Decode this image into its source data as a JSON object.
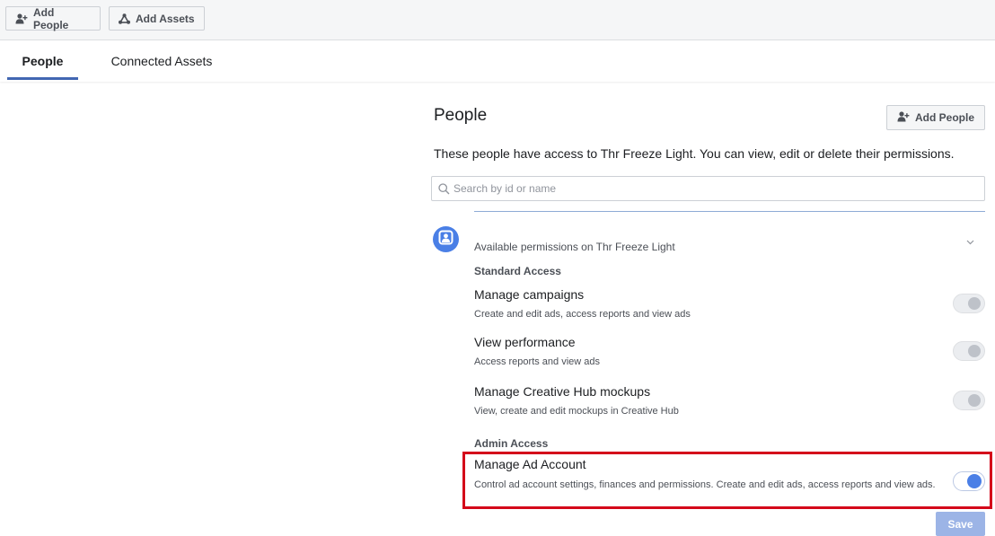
{
  "toolbar": {
    "add_people_label": "Add People",
    "add_assets_label": "Add Assets"
  },
  "tabs": [
    {
      "label": "People",
      "active": true
    },
    {
      "label": "Connected Assets",
      "active": false
    }
  ],
  "panel": {
    "title": "People",
    "add_people_label": "Add People",
    "description": "These people have access to Thr Freeze Light. You can view, edit or delete their permissions.",
    "search_placeholder": "Search by id or name",
    "available_label": "Available permissions on Thr Freeze Light",
    "standard_heading": "Standard Access",
    "admin_heading": "Admin Access",
    "permissions": [
      {
        "title": "Manage campaigns",
        "description": "Create and edit ads, access reports and view ads",
        "enabled": false
      },
      {
        "title": "View performance",
        "description": "Access reports and view ads",
        "enabled": false
      },
      {
        "title": "Manage Creative Hub mockups",
        "description": "View, create and edit mockups in Creative Hub",
        "enabled": false
      },
      {
        "title": "Manage Ad Account",
        "description": "Control ad account settings, finances and permissions. Create and edit ads, access reports and view ads.",
        "enabled": true
      }
    ],
    "save_label": "Save"
  },
  "colors": {
    "accent": "#4267b2",
    "toggle_on": "#4a7fe6",
    "highlight": "#d4061a",
    "save_disabled": "#9cb4e6"
  }
}
